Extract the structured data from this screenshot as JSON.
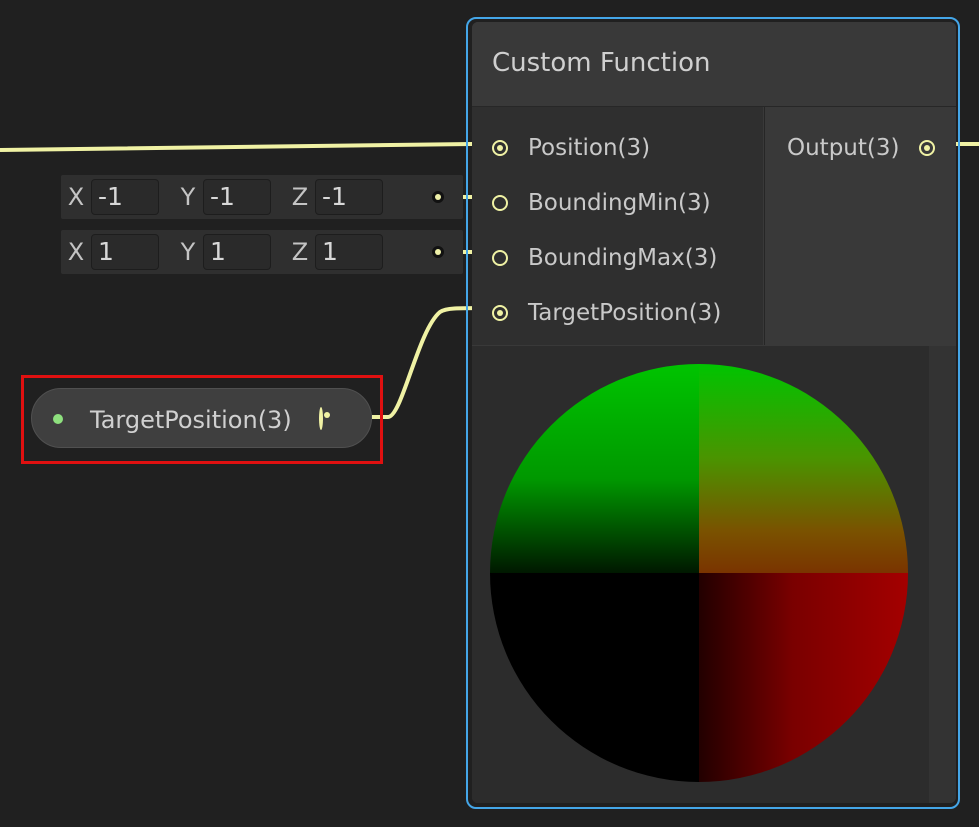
{
  "node": {
    "title": "Custom Function",
    "inputs": [
      {
        "label": "Position(3)",
        "connected": true
      },
      {
        "label": "BoundingMin(3)",
        "connected": true
      },
      {
        "label": "BoundingMax(3)",
        "connected": true
      },
      {
        "label": "TargetPosition(3)",
        "connected": true
      }
    ],
    "outputs": [
      {
        "label": "Output(3)",
        "connected": true
      }
    ]
  },
  "fields": {
    "bounding_min": {
      "x_label": "X",
      "x": "-1",
      "y_label": "Y",
      "y": "-1",
      "z_label": "Z",
      "z": "-1"
    },
    "bounding_max": {
      "x_label": "X",
      "x": "1",
      "y_label": "Y",
      "y": "1",
      "z_label": "Z",
      "z": "1"
    }
  },
  "property_node": {
    "label": "TargetPosition(3)"
  },
  "colors": {
    "wire": "#f0f2a4",
    "selection": "#44a6e8",
    "highlight": "#e01010",
    "property_dot": "#8ee07e"
  }
}
